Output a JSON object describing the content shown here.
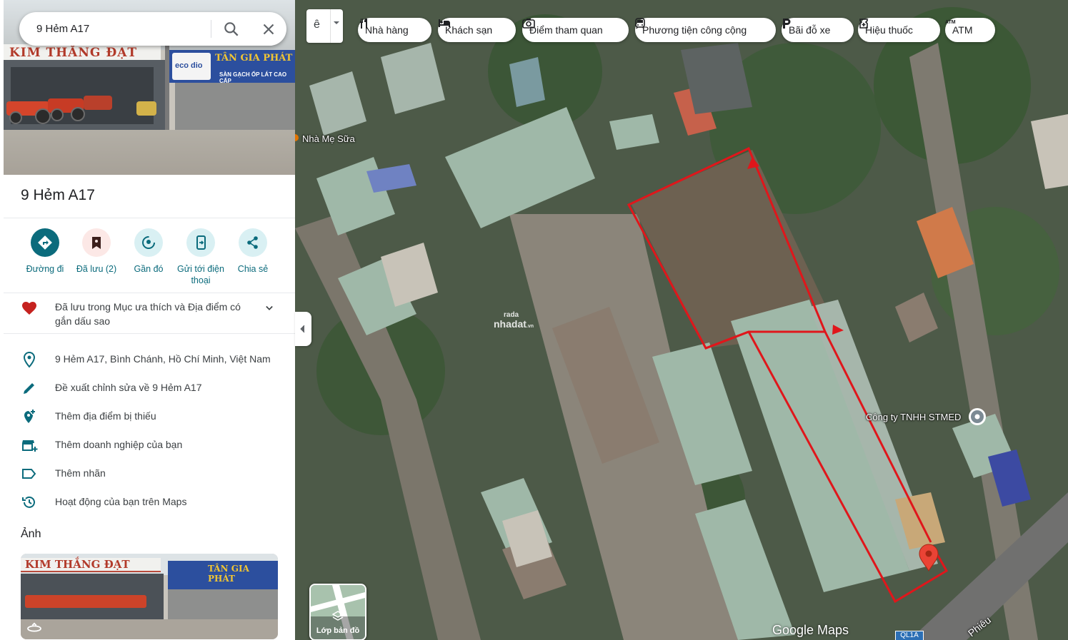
{
  "search": {
    "value": "9 Hẻm A17"
  },
  "hero_photo": {
    "sign_left": "KIM THẮNG ĐẠT",
    "sign_right": "TÂN GIA PHÁT",
    "sign_right_sub": "SÀN GẠCH ỐP LÁT CAO CẤP",
    "logo": "eco dio"
  },
  "place": {
    "title": "9 Hẻm A17"
  },
  "actions": [
    {
      "label": "Đường đi",
      "icon": "directions-icon"
    },
    {
      "label": "Đã lưu (2)",
      "icon": "saved-bookmark-icon"
    },
    {
      "label": "Gần đó",
      "icon": "nearby-icon"
    },
    {
      "label": "Gửi tới điện thoại",
      "icon": "send-to-phone-icon"
    },
    {
      "label": "Chia sẻ",
      "icon": "share-icon"
    }
  ],
  "favorite": {
    "text": "Đã lưu trong Mục ưa thích và Địa điểm có gắn dấu sao"
  },
  "info": [
    {
      "text": "9 Hẻm A17, Bình Chánh, Hồ Chí Minh, Việt Nam",
      "icon": "location-pin-icon"
    },
    {
      "text": "Đề xuất chỉnh sửa về 9 Hẻm A17",
      "icon": "edit-pencil-icon"
    },
    {
      "text": "Thêm địa điểm bị thiếu",
      "icon": "add-place-icon"
    },
    {
      "text": "Thêm doanh nghiệp của bạn",
      "icon": "add-business-icon"
    },
    {
      "text": "Thêm nhãn",
      "icon": "label-icon"
    },
    {
      "text": "Hoạt động của bạn trên Maps",
      "icon": "history-icon"
    }
  ],
  "photos": {
    "heading": "Ảnh"
  },
  "map": {
    "lang_glyph": "ê",
    "chips": [
      {
        "label": "Nhà hàng",
        "icon": "restaurant-icon"
      },
      {
        "label": "Khách sạn",
        "icon": "hotel-icon"
      },
      {
        "label": "Điểm tham quan",
        "icon": "camera-icon"
      },
      {
        "label": "Phương tiện công cộng",
        "icon": "transit-icon"
      },
      {
        "label": "Bãi đỗ xe",
        "icon": "parking-icon"
      },
      {
        "label": "Hiệu thuốc",
        "icon": "pharmacy-icon"
      },
      {
        "label": "ATM",
        "icon": "atm-icon"
      }
    ],
    "labels": {
      "milk_shop": "Nhà Mẹ Sữa",
      "company": "Công ty TNHH STMED",
      "road": "Phiêu"
    },
    "route_badge": "QL1A",
    "logo": "Google Maps",
    "layers_label": "Lớp bản đồ",
    "watermark_top": "rada",
    "watermark_bottom": "nhadat",
    "watermark_suffix": ".vn"
  },
  "colors": {
    "accent_teal": "#0b6b7c",
    "saved_red": "#c5221f",
    "annotation_red": "#e0161b"
  }
}
